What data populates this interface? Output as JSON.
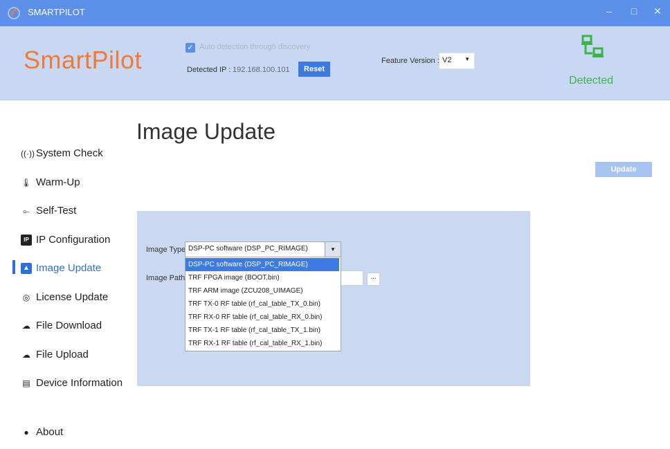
{
  "window": {
    "title": "SMARTPILOT",
    "controls": {
      "minimize": "–",
      "maximize": "□",
      "close": "✕"
    }
  },
  "header": {
    "brand": "SmartPilot",
    "auto_detect_label": "Auto detection through discovery",
    "auto_detect_checked": true,
    "detected_ip_label": "Detected IP :",
    "detected_ip_value": "192.168.100.101",
    "reset_label": "Reset",
    "feature_version_label": "Feature Version :",
    "feature_version_value": "V2",
    "status_text": "Detected",
    "status_color": "#3cb44b"
  },
  "sidebar": {
    "items": [
      {
        "label": "System Check",
        "icon": "signal-icon"
      },
      {
        "label": "Warm-Up",
        "icon": "thermometer-icon"
      },
      {
        "label": "Self-Test",
        "icon": "pulse-icon"
      },
      {
        "label": "IP Configuration",
        "icon": "ip-icon"
      },
      {
        "label": "Image Update",
        "icon": "image-upload-icon",
        "active": true
      },
      {
        "label": "License Update",
        "icon": "certificate-icon"
      },
      {
        "label": "File Download",
        "icon": "cloud-download-icon"
      },
      {
        "label": "File Upload",
        "icon": "cloud-upload-icon"
      },
      {
        "label": "Device Information",
        "icon": "device-info-icon"
      },
      {
        "label": "About",
        "icon": "chat-icon"
      }
    ]
  },
  "main": {
    "title": "Image Update",
    "update_label": "Update",
    "image_type_label": "Image Type",
    "image_path_label": "Image Path",
    "image_type_value": "DSP-PC software (DSP_PC_RIMAGE)",
    "browse_label": "...",
    "options": [
      "DSP-PC software (DSP_PC_RIMAGE)",
      "TRF FPGA image (BOOT.bin)",
      "TRF ARM image (ZCU208_UIMAGE)",
      "TRF TX-0 RF table (rf_cal_table_TX_0.bin)",
      "TRF RX-0 RF table (rf_cal_table_RX_0.bin)",
      "TRF TX-1 RF table (rf_cal_table_TX_1.bin)",
      "TRF RX-1 RF table (rf_cal_table_RX_1.bin)"
    ]
  },
  "colors": {
    "titlebar": "#5b8fe8",
    "header": "#c9d8f2",
    "brand": "#f07a3a",
    "accent": "#3d7be3",
    "panel": "#cad9f1"
  }
}
